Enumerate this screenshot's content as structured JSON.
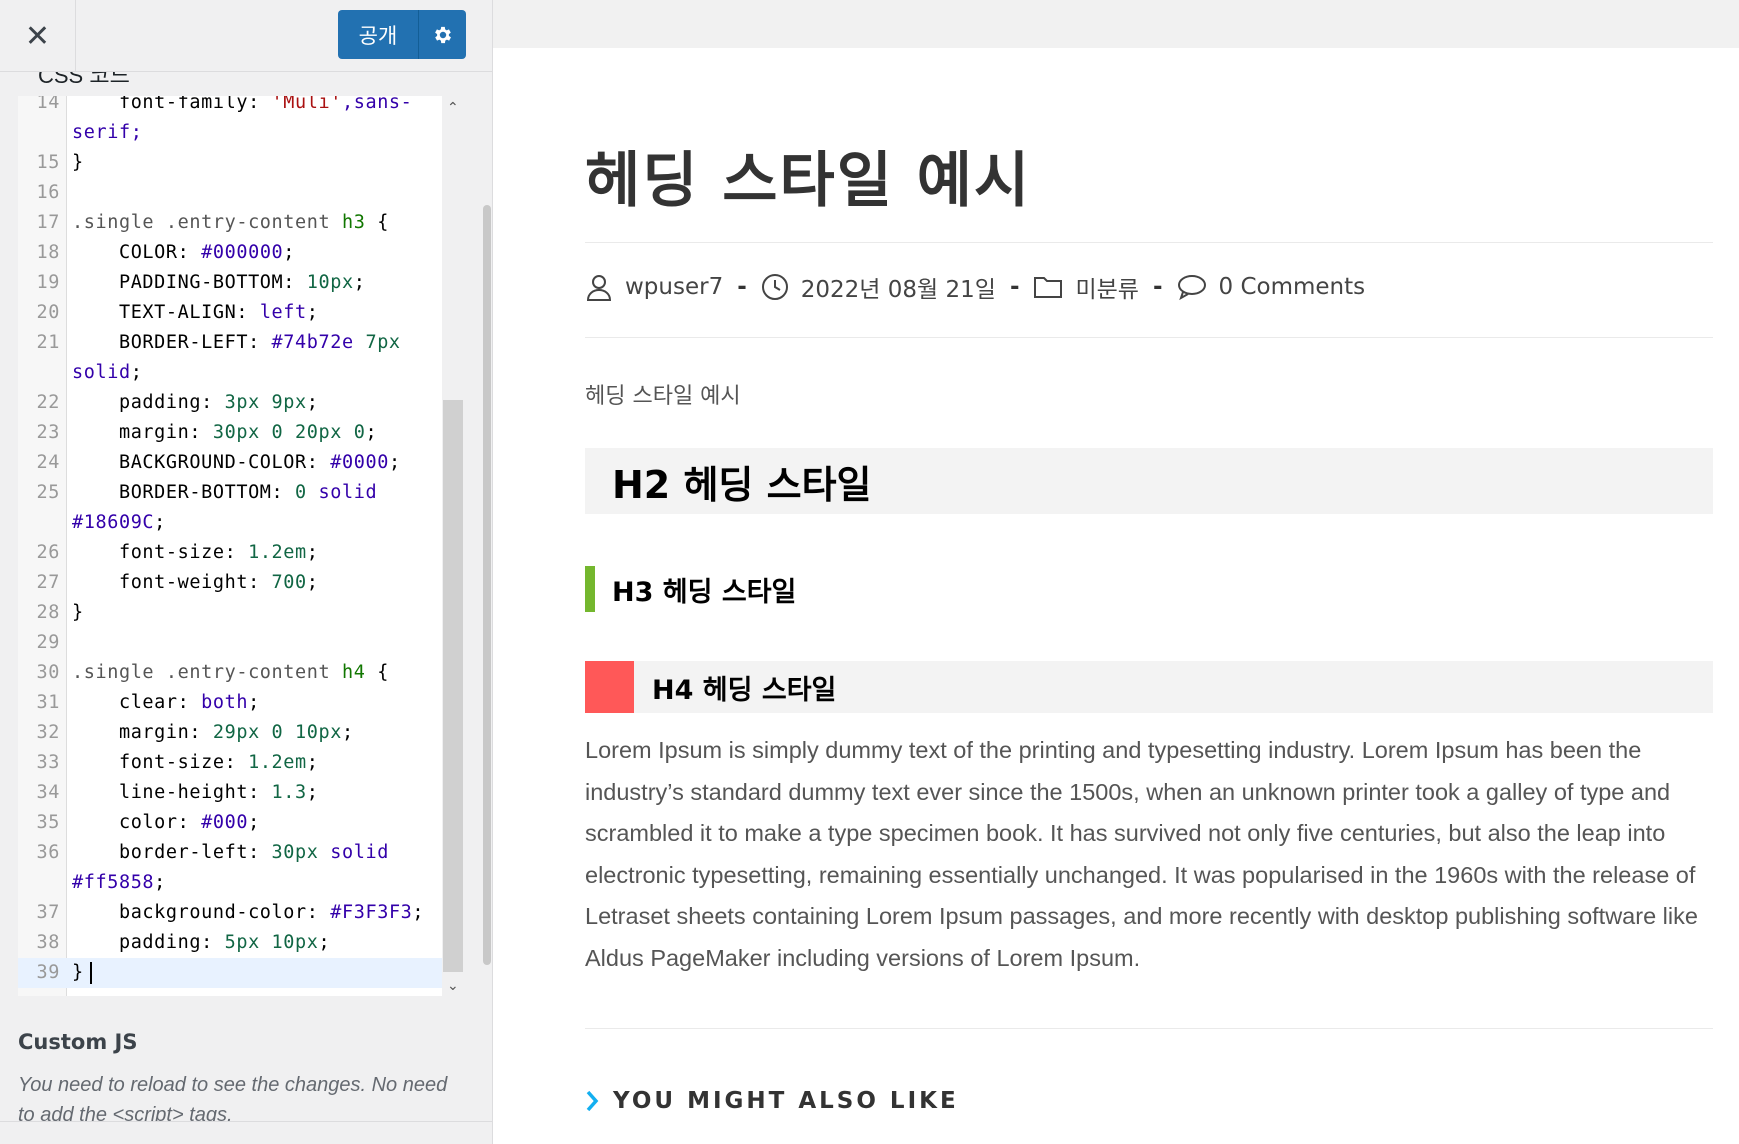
{
  "customizer": {
    "close_label": "✕",
    "publish_label": "공개",
    "section_label": "CSS 코드",
    "editor": {
      "lines": [
        {
          "num": "14",
          "tokens": [
            {
              "t": "    font-family: ",
              "c": "prop"
            },
            {
              "t": "'Muli'",
              "c": "str"
            },
            {
              "t": ",sans-\nserif;",
              "c": "val"
            }
          ]
        },
        {
          "num": "15",
          "tokens": [
            {
              "t": "}",
              "c": "prop"
            }
          ]
        },
        {
          "num": "16",
          "tokens": []
        },
        {
          "num": "17",
          "tokens": [
            {
              "t": ".single .entry-content ",
              "c": "sel"
            },
            {
              "t": "h3",
              "c": "tag"
            },
            {
              "t": " {",
              "c": "prop"
            }
          ]
        },
        {
          "num": "18",
          "tokens": [
            {
              "t": "    COLOR: ",
              "c": "prop"
            },
            {
              "t": "#000000",
              "c": "val"
            },
            {
              "t": ";",
              "c": "prop"
            }
          ]
        },
        {
          "num": "19",
          "tokens": [
            {
              "t": "    PADDING-BOTTOM: ",
              "c": "prop"
            },
            {
              "t": "10px",
              "c": "num"
            },
            {
              "t": ";",
              "c": "prop"
            }
          ]
        },
        {
          "num": "20",
          "tokens": [
            {
              "t": "    TEXT-ALIGN: ",
              "c": "prop"
            },
            {
              "t": "left",
              "c": "val"
            },
            {
              "t": ";",
              "c": "prop"
            }
          ]
        },
        {
          "num": "21",
          "tokens": [
            {
              "t": "    BORDER-LEFT: ",
              "c": "prop"
            },
            {
              "t": "#74b72e",
              "c": "val"
            },
            {
              "t": " 7px",
              "c": "num"
            },
            {
              "t": "\nsolid",
              "c": "val"
            },
            {
              "t": ";",
              "c": "prop"
            }
          ]
        },
        {
          "num": "22",
          "tokens": [
            {
              "t": "    padding: ",
              "c": "prop"
            },
            {
              "t": "3px 9px",
              "c": "num"
            },
            {
              "t": ";",
              "c": "prop"
            }
          ]
        },
        {
          "num": "23",
          "tokens": [
            {
              "t": "    margin: ",
              "c": "prop"
            },
            {
              "t": "30px 0 20px 0",
              "c": "num"
            },
            {
              "t": ";",
              "c": "prop"
            }
          ]
        },
        {
          "num": "24",
          "tokens": [
            {
              "t": "    BACKGROUND-COLOR: ",
              "c": "prop"
            },
            {
              "t": "#0000",
              "c": "val"
            },
            {
              "t": ";",
              "c": "prop"
            }
          ]
        },
        {
          "num": "25",
          "tokens": [
            {
              "t": "    BORDER-BOTTOM: ",
              "c": "prop"
            },
            {
              "t": "0",
              "c": "num"
            },
            {
              "t": " solid\n#18609C",
              "c": "val"
            },
            {
              "t": ";",
              "c": "prop"
            }
          ]
        },
        {
          "num": "26",
          "tokens": [
            {
              "t": "    font-size: ",
              "c": "prop"
            },
            {
              "t": "1.2em",
              "c": "num"
            },
            {
              "t": ";",
              "c": "prop"
            }
          ]
        },
        {
          "num": "27",
          "tokens": [
            {
              "t": "    font-weight: ",
              "c": "prop"
            },
            {
              "t": "700",
              "c": "num"
            },
            {
              "t": ";",
              "c": "prop"
            }
          ]
        },
        {
          "num": "28",
          "tokens": [
            {
              "t": "}",
              "c": "prop"
            }
          ]
        },
        {
          "num": "29",
          "tokens": []
        },
        {
          "num": "30",
          "tokens": [
            {
              "t": ".single .entry-content ",
              "c": "sel"
            },
            {
              "t": "h4",
              "c": "tag"
            },
            {
              "t": " {",
              "c": "prop"
            }
          ]
        },
        {
          "num": "31",
          "tokens": [
            {
              "t": "    clear: ",
              "c": "prop"
            },
            {
              "t": "both",
              "c": "val"
            },
            {
              "t": ";",
              "c": "prop"
            }
          ]
        },
        {
          "num": "32",
          "tokens": [
            {
              "t": "    margin: ",
              "c": "prop"
            },
            {
              "t": "29px 0 10px",
              "c": "num"
            },
            {
              "t": ";",
              "c": "prop"
            }
          ]
        },
        {
          "num": "33",
          "tokens": [
            {
              "t": "    font-size: ",
              "c": "prop"
            },
            {
              "t": "1.2em",
              "c": "num"
            },
            {
              "t": ";",
              "c": "prop"
            }
          ]
        },
        {
          "num": "34",
          "tokens": [
            {
              "t": "    line-height: ",
              "c": "prop"
            },
            {
              "t": "1.3",
              "c": "num"
            },
            {
              "t": ";",
              "c": "prop"
            }
          ]
        },
        {
          "num": "35",
          "tokens": [
            {
              "t": "    color: ",
              "c": "prop"
            },
            {
              "t": "#000",
              "c": "val"
            },
            {
              "t": ";",
              "c": "prop"
            }
          ]
        },
        {
          "num": "36",
          "tokens": [
            {
              "t": "    border-left: ",
              "c": "prop"
            },
            {
              "t": "30px",
              "c": "num"
            },
            {
              "t": " solid\n#ff5858",
              "c": "val"
            },
            {
              "t": ";",
              "c": "prop"
            }
          ]
        },
        {
          "num": "37",
          "tokens": [
            {
              "t": "    background-color: ",
              "c": "prop"
            },
            {
              "t": "#F3F3F3",
              "c": "val"
            },
            {
              "t": ";",
              "c": "prop"
            }
          ]
        },
        {
          "num": "38",
          "tokens": [
            {
              "t": "    padding: ",
              "c": "prop"
            },
            {
              "t": "5px 10px",
              "c": "num"
            },
            {
              "t": ";",
              "c": "prop"
            }
          ]
        },
        {
          "num": "39",
          "tokens": [
            {
              "t": "}",
              "c": "prop"
            }
          ],
          "active": true
        }
      ]
    },
    "custom_js": {
      "title": "Custom JS",
      "description": "You need to reload to see the changes. No need to add the <script> tags."
    }
  },
  "preview": {
    "post_title": "헤딩 스타일 예시",
    "meta": {
      "author": "wpuser7",
      "date": "2022년 08월 21일",
      "category": "미분류",
      "comments": "0 Comments",
      "separator": "-"
    },
    "intro_text": "헤딩 스타일 예시",
    "h2_text": "H2 헤딩 스타일",
    "h3_text": "H3 헤딩 스타일",
    "h4_text": "H4 헤딩 스타일",
    "lorem": "Lorem Ipsum is simply dummy text of the printing and typesetting industry. Lorem Ipsum has been the industry’s standard dummy text ever since the 1500s, when an unknown printer took a galley of type and scrambled it to make a type specimen book. It has survived not only five centuries, but also the leap into electronic typesetting, remaining essentially unchanged. It was popularised in the 1960s with the release of Letraset sheets containing Lorem Ipsum passages, and more recently with desktop publishing software like Aldus PageMaker including versions of Lorem Ipsum.",
    "related_title": "YOU MIGHT ALSO LIKE"
  },
  "colors": {
    "publish_blue": "#2271b1",
    "h3_border": "#74b72e",
    "h4_border": "#ff5858",
    "heading_bg": "#F3F3F3",
    "related_chevron": "#13aff0"
  },
  "icons": {
    "close": "close-icon",
    "publish_settings": "gear-icon",
    "author": "user-icon",
    "date": "clock-icon",
    "category": "folder-icon",
    "comments": "comment-icon",
    "related": "chevron-right-icon"
  }
}
